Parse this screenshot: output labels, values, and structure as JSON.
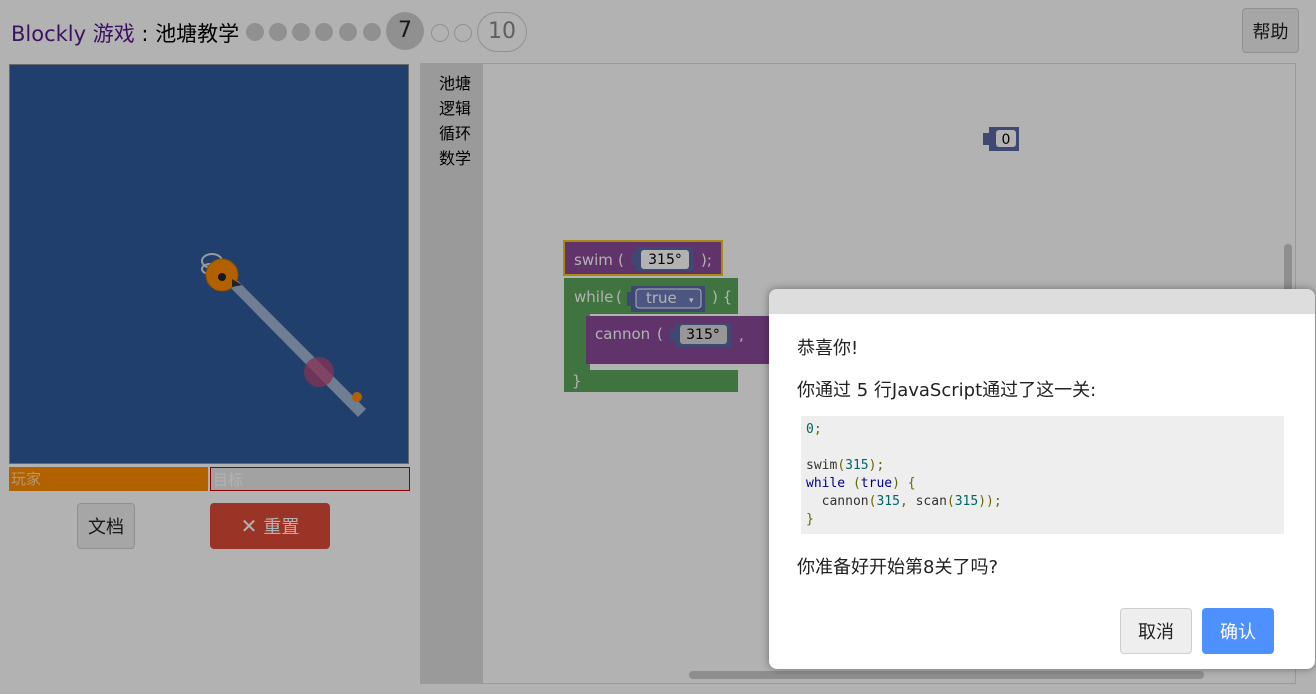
{
  "header": {
    "brand": "Blockly",
    "game": "游戏",
    "separator": " : ",
    "page_title": "池塘教学",
    "levels": [
      "1",
      "2",
      "3",
      "4",
      "5",
      "6",
      "7",
      "8",
      "9",
      "10"
    ],
    "current_level": "7",
    "last_level": "10",
    "help_label": "帮助"
  },
  "visualization": {
    "player_label": "玩家",
    "target_label": "目标",
    "docs_label": "文档",
    "reset_label": "重置",
    "player_health": 1.0,
    "target_health": 0.0
  },
  "toolbox": {
    "categories": [
      "池塘",
      "逻辑",
      "循环",
      "数学"
    ]
  },
  "workspace": {
    "number_block": "0",
    "swim_block": {
      "keyword": "swim",
      "open": "(",
      "angle": "315°",
      "close": ");"
    },
    "while_block": {
      "keyword": "while",
      "open": "(",
      "condition": "true",
      "close": ") {",
      "end": "}"
    },
    "cannon_block": {
      "keyword": "cannon",
      "open": "(",
      "angle": "315°",
      "comma": ","
    }
  },
  "dialog": {
    "congrats": "恭喜你!",
    "summary": "你通过 5 行JavaScript通过了这一关:",
    "code_lines": [
      "0;",
      "",
      "swim(315);",
      "while (true) {",
      "  cannon(315, scan(315));",
      "}"
    ],
    "question": "你准备好开始第8关了吗?",
    "cancel_label": "取消",
    "ok_label": "确认"
  },
  "colors": {
    "pond": "#2e5b9c",
    "player": "#ff8b00",
    "reset_button": "#dd4b39",
    "ok_button": "#4d90fe",
    "pond_block": "#8a4a99",
    "logic_block": "#5b67a5",
    "loop_block": "#5ba55b"
  }
}
